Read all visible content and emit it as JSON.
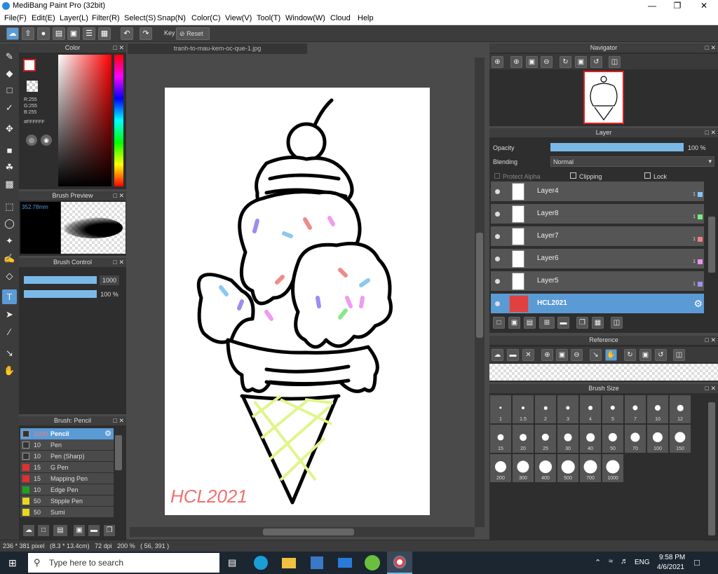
{
  "window": {
    "title": "MediBang Paint Pro (32bit)"
  },
  "menu": [
    "File(F)",
    "Edit(E)",
    "Layer(L)",
    "Filter(R)",
    "Select(S)",
    "Snap(N)",
    "Color(C)",
    "View(V)",
    "Tool(T)",
    "Window(W)",
    "Cloud",
    "Help"
  ],
  "toolbar": {
    "key_label": "Key",
    "reset_label": "Reset"
  },
  "color_panel": {
    "title": "Color",
    "r": "R:255",
    "g": "G:255",
    "b": "B:255",
    "hex": "#FFFFFF"
  },
  "brush_preview": {
    "title": "Brush Preview",
    "size": "352.78mm"
  },
  "brush_control": {
    "title": "Brush Control",
    "size_value": "1000",
    "opacity_value": "100 %"
  },
  "brush_list": {
    "title": "Brush: Pencil",
    "items": [
      {
        "size": "1000",
        "name": "Pencil",
        "color": "#333333"
      },
      {
        "size": "10",
        "name": "Pen",
        "color": "#333333"
      },
      {
        "size": "10",
        "name": "Pen (Sharp)",
        "color": "#333333"
      },
      {
        "size": "15",
        "name": "G Pen",
        "color": "#e03030"
      },
      {
        "size": "15",
        "name": "Mapping Pen",
        "color": "#e03030"
      },
      {
        "size": "10",
        "name": "Edge Pen",
        "color": "#20a020"
      },
      {
        "size": "50",
        "name": "Stipple Pen",
        "color": "#e8d820"
      },
      {
        "size": "50",
        "name": "Sumi",
        "color": "#e8d820"
      }
    ]
  },
  "document": {
    "tab": "tranh-to-mau-kem-oc-que-1.jpg",
    "signature": "HCL2021"
  },
  "status": {
    "text": "236 * 381 pixel   (8.3 * 13.4cm)   72 dpi   200 %   ( 56, 391 )"
  },
  "navigator": {
    "title": "Navigator"
  },
  "layer_panel": {
    "title": "Layer",
    "opacity_label": "Opacity",
    "opacity_value": "100 %",
    "opacity_fraction": 1.0,
    "blending_label": "Blending",
    "blending_value": "Normal",
    "protect_alpha": "Protect Alpha",
    "clipping": "Clipping",
    "lock": "Lock",
    "layers": [
      {
        "name": "Layer4",
        "color": "#7fc8f8",
        "num": "1"
      },
      {
        "name": "Layer8",
        "color": "#7fe87f",
        "num": "1"
      },
      {
        "name": "Layer7",
        "color": "#f08080",
        "num": "1"
      },
      {
        "name": "Layer6",
        "color": "#f090f0",
        "num": "1"
      },
      {
        "name": "Layer5",
        "color": "#a090f0",
        "num": "1"
      },
      {
        "name": "HCL2021",
        "color": "",
        "num": ""
      }
    ]
  },
  "reference": {
    "title": "Reference"
  },
  "brush_size": {
    "title": "Brush Size",
    "sizes": [
      "1",
      "1.5",
      "2",
      "3",
      "4",
      "5",
      "7",
      "10",
      "12",
      "15",
      "20",
      "25",
      "30",
      "40",
      "50",
      "70",
      "100",
      "150",
      "200",
      "300",
      "400",
      "500",
      "700",
      "1000"
    ]
  },
  "taskbar": {
    "search_placeholder": "Type here to search",
    "lang": "ENG",
    "time": "9:58 PM",
    "date": "4/6/2021"
  }
}
